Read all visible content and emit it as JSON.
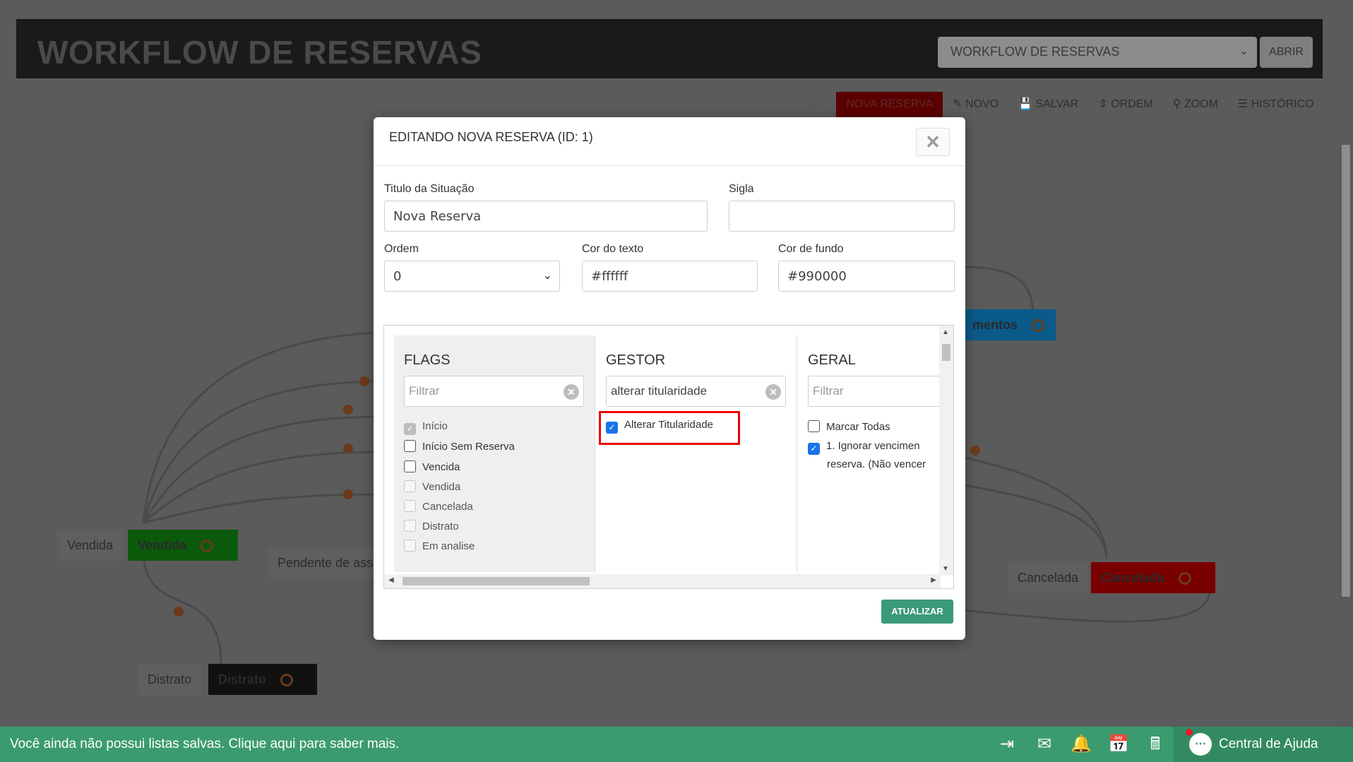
{
  "header": {
    "title": "WORKFLOW DE RESERVAS",
    "workflow_select": "WORKFLOW DE RESERVAS",
    "open_button": "ABRIR"
  },
  "toolbar": {
    "version": "v2.1",
    "active_item": "NOVA RESERVA",
    "items": [
      "NOVO",
      "SALVAR",
      "ORDEM",
      "ZOOM",
      "HISTÓRICO"
    ]
  },
  "canvas": {
    "nodes": [
      {
        "label": "Vendida",
        "box": "Vendida",
        "color": "#0b5a0b"
      },
      {
        "label": "Pendente de ass",
        "box": ""
      },
      {
        "label": "Distrato",
        "box": "Distrato",
        "color": "#111111"
      },
      {
        "label": "Cancelada",
        "box": "Cancelada",
        "color": "#7a0000"
      },
      {
        "label": "",
        "box": "mentos",
        "color": "#0a5a8a"
      }
    ]
  },
  "modal": {
    "title": "EDITANDO NOVA RESERVA (ID: 1)",
    "fields": {
      "titulo_label": "Titulo da Situação",
      "titulo_value": "Nova Reserva",
      "sigla_label": "Sigla",
      "sigla_value": "",
      "ordem_label": "Ordem",
      "ordem_value": "0",
      "cor_texto_label": "Cor do texto",
      "cor_texto_value": "#ffffff",
      "cor_fundo_label": "Cor de fundo",
      "cor_fundo_value": "#990000"
    },
    "flags": {
      "title": "FLAGS",
      "filter_placeholder": "Filtrar",
      "items": [
        {
          "label": "Início",
          "state": "disabled-checked"
        },
        {
          "label": "Início Sem Reserva",
          "state": "unchecked"
        },
        {
          "label": "Vencida",
          "state": "unchecked"
        },
        {
          "label": "Vendida",
          "state": "disabled"
        },
        {
          "label": "Cancelada",
          "state": "disabled"
        },
        {
          "label": "Distrato",
          "state": "disabled"
        },
        {
          "label": "Em analise",
          "state": "disabled"
        }
      ]
    },
    "gestor": {
      "title": "GESTOR",
      "filter_value": "alterar titularidade",
      "items": [
        {
          "label": "Alterar Titularidade",
          "state": "checked"
        }
      ]
    },
    "geral": {
      "title": "GERAL",
      "filter_placeholder": "Filtrar",
      "items": [
        {
          "label": "Marcar Todas",
          "state": "unchecked"
        },
        {
          "label": "1. Ignorar vencimen",
          "line2": "reserva. (Não vencer",
          "state": "checked"
        }
      ]
    },
    "update_button": "ATUALIZAR"
  },
  "bottom_bar": {
    "message": "Você ainda não possui listas salvas. Clique aqui para saber mais.",
    "help_label": "Central de Ajuda"
  }
}
